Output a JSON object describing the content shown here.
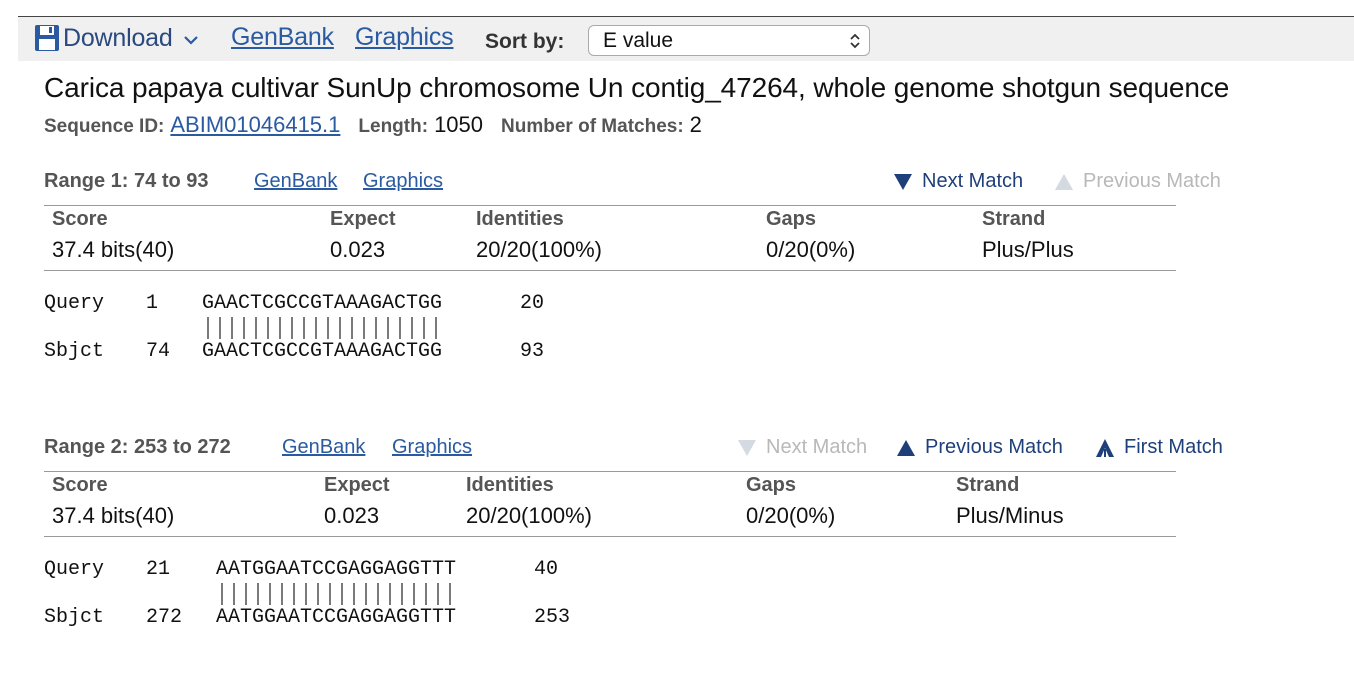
{
  "toolbar": {
    "download_label": "Download",
    "download_icon": "floppy-disk-icon",
    "genbank_label": "GenBank",
    "graphics_label": "Graphics",
    "sort_label": "Sort by:",
    "sort_value": "E value"
  },
  "header": {
    "title": "Carica papaya cultivar SunUp chromosome Un contig_47264, whole genome shotgun sequence",
    "seq_id_label": "Sequence ID:",
    "seq_id": "ABIM01046415.1",
    "length_label": "Length:",
    "length": "1050",
    "matches_label": "Number of Matches:",
    "matches": "2"
  },
  "ranges": [
    {
      "title": "Range 1: 74 to 93",
      "genbank": "GenBank",
      "graphics": "Graphics",
      "next_match": "Next Match",
      "previous_match": "Previous Match",
      "headers": [
        "Score",
        "Expect",
        "Identities",
        "Gaps",
        "Strand"
      ],
      "values": [
        "37.4 bits(40)",
        "0.023",
        "20/20(100%)",
        "0/20(0%)",
        "Plus/Plus"
      ],
      "query_label": "Query",
      "query_start": "1",
      "query_seq": "GAACTCGCCGTAAAGACTGG",
      "query_end": "20",
      "sbjct_label": "Sbjct",
      "sbjct_start": "74",
      "sbjct_seq": "GAACTCGCCGTAAAGACTGG",
      "sbjct_end": "93"
    },
    {
      "title": "Range 2: 253 to 272",
      "genbank": "GenBank",
      "graphics": "Graphics",
      "next_match": "Next Match",
      "previous_match": "Previous Match",
      "first_match": "First Match",
      "headers": [
        "Score",
        "Expect",
        "Identities",
        "Gaps",
        "Strand"
      ],
      "values": [
        "37.4 bits(40)",
        "0.023",
        "20/20(100%)",
        "0/20(0%)",
        "Plus/Minus"
      ],
      "query_label": "Query",
      "query_start": "21",
      "query_seq": "AATGGAATCCGAGGAGGTTT",
      "query_end": "40",
      "sbjct_label": "Sbjct",
      "sbjct_start": "272",
      "sbjct_seq": "AATGGAATCCGAGGAGGTTT",
      "sbjct_end": "253"
    }
  ],
  "colors": {
    "link": "#2a5aa0",
    "nav_enabled": "#1f3f7a",
    "nav_disabled": "#b8b8b8",
    "toolbar_bg": "#f0f0f0"
  }
}
